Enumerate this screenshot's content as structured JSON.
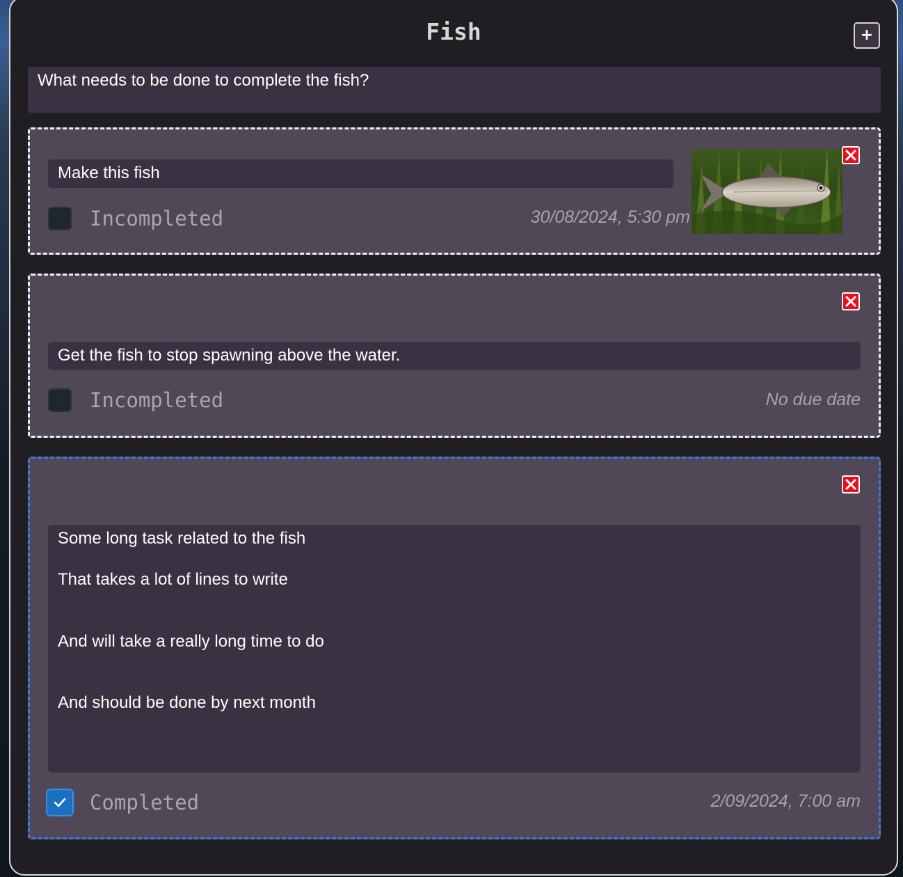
{
  "panel": {
    "title": "Fish",
    "add_label": "+",
    "goal_placeholder": "What needs to be done to complete the fish?"
  },
  "tasks": [
    {
      "text": "Make this fish",
      "status": "Incompleted",
      "completed": false,
      "due": "30/08/2024, 5:30 pm",
      "has_image": true
    },
    {
      "text": "Get the fish to stop spawning above the water.",
      "status": "Incompleted",
      "completed": false,
      "due": "No due date",
      "has_image": false
    },
    {
      "text": "Some long task related to the fish\n\nThat takes a lot of lines to write\n\n\nAnd will take a really long time to do\n\n\nAnd should be done by next month",
      "status": "Completed",
      "completed": true,
      "due": "2/09/2024, 7:00 am",
      "has_image": false
    }
  ],
  "icons": {
    "add": "plus-icon",
    "delete": "close-icon",
    "check": "check-icon"
  },
  "colors": {
    "panel_bg": "#211e23",
    "card_bg": "#504757",
    "input_bg": "#3a3142",
    "active_border": "#3b7dd8",
    "delete_red": "#e8101a",
    "checked_blue": "#1a6fbf"
  }
}
